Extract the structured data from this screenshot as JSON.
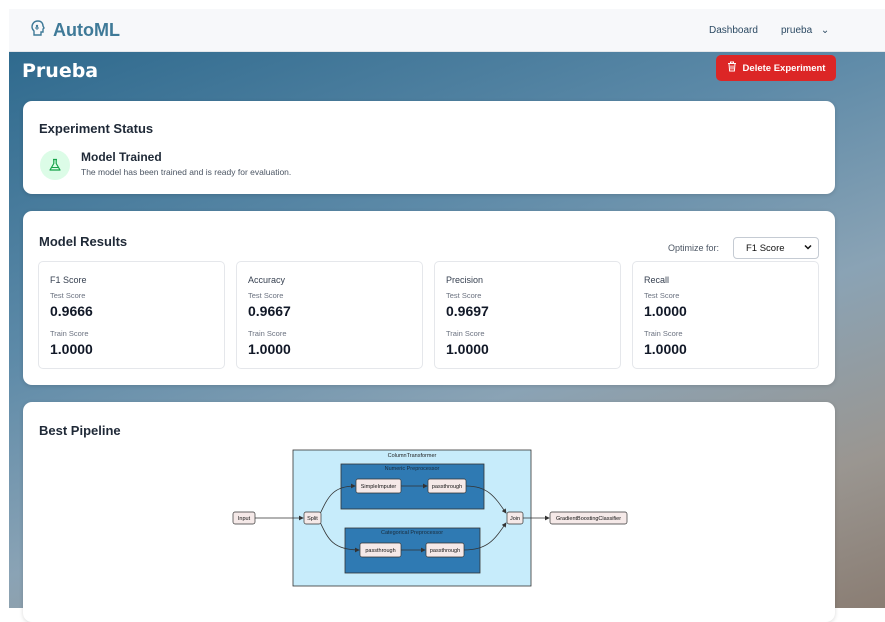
{
  "navbar": {
    "brand": "AutoML",
    "dashboard_link": "Dashboard",
    "user_menu": "prueba",
    "user_menu_chevron": "⌄"
  },
  "page": {
    "title": "Prueba",
    "delete_button": "Delete Experiment"
  },
  "status": {
    "heading": "Experiment Status",
    "state_title": "Model Trained",
    "state_description": "The model has been trained and is ready for evaluation."
  },
  "results": {
    "heading": "Model Results",
    "optimize_label": "Optimize for:",
    "optimize_value": "F1 Score",
    "metrics": [
      {
        "name": "F1 Score",
        "test_label": "Test Score",
        "test_value": "0.9666",
        "train_label": "Train Score",
        "train_value": "1.0000"
      },
      {
        "name": "Accuracy",
        "test_label": "Test Score",
        "test_value": "0.9667",
        "train_label": "Train Score",
        "train_value": "1.0000"
      },
      {
        "name": "Precision",
        "test_label": "Test Score",
        "test_value": "0.9697",
        "train_label": "Train Score",
        "train_value": "1.0000"
      },
      {
        "name": "Recall",
        "test_label": "Test Score",
        "test_value": "1.0000",
        "train_label": "Train Score",
        "train_value": "1.0000"
      }
    ]
  },
  "pipeline": {
    "heading": "Best Pipeline",
    "column_transformer": "ColumnTransformer",
    "numeric_group": "Numeric Preprocessor",
    "categorical_group": "Categorical Preprocessor",
    "nodes": {
      "input": "Input",
      "split": "Split",
      "simple_imputer": "SimpleImputer",
      "num_passthrough": "passthrough",
      "cat_passthrough_1": "passthrough",
      "cat_passthrough_2": "passthrough",
      "join": "Join",
      "classifier": "GradientBoostingClassifier"
    }
  },
  "colors": {
    "brand": "#3f7a98",
    "danger": "#dc2626",
    "success_bg": "#dcfce7",
    "success_icon": "#16a34a",
    "transformer_bg": "#c7ecfb",
    "group_bg": "#2f7ab3"
  },
  "icons": {
    "brand": "brain-circuit-icon",
    "delete": "trash-icon",
    "status": "flask-icon"
  }
}
